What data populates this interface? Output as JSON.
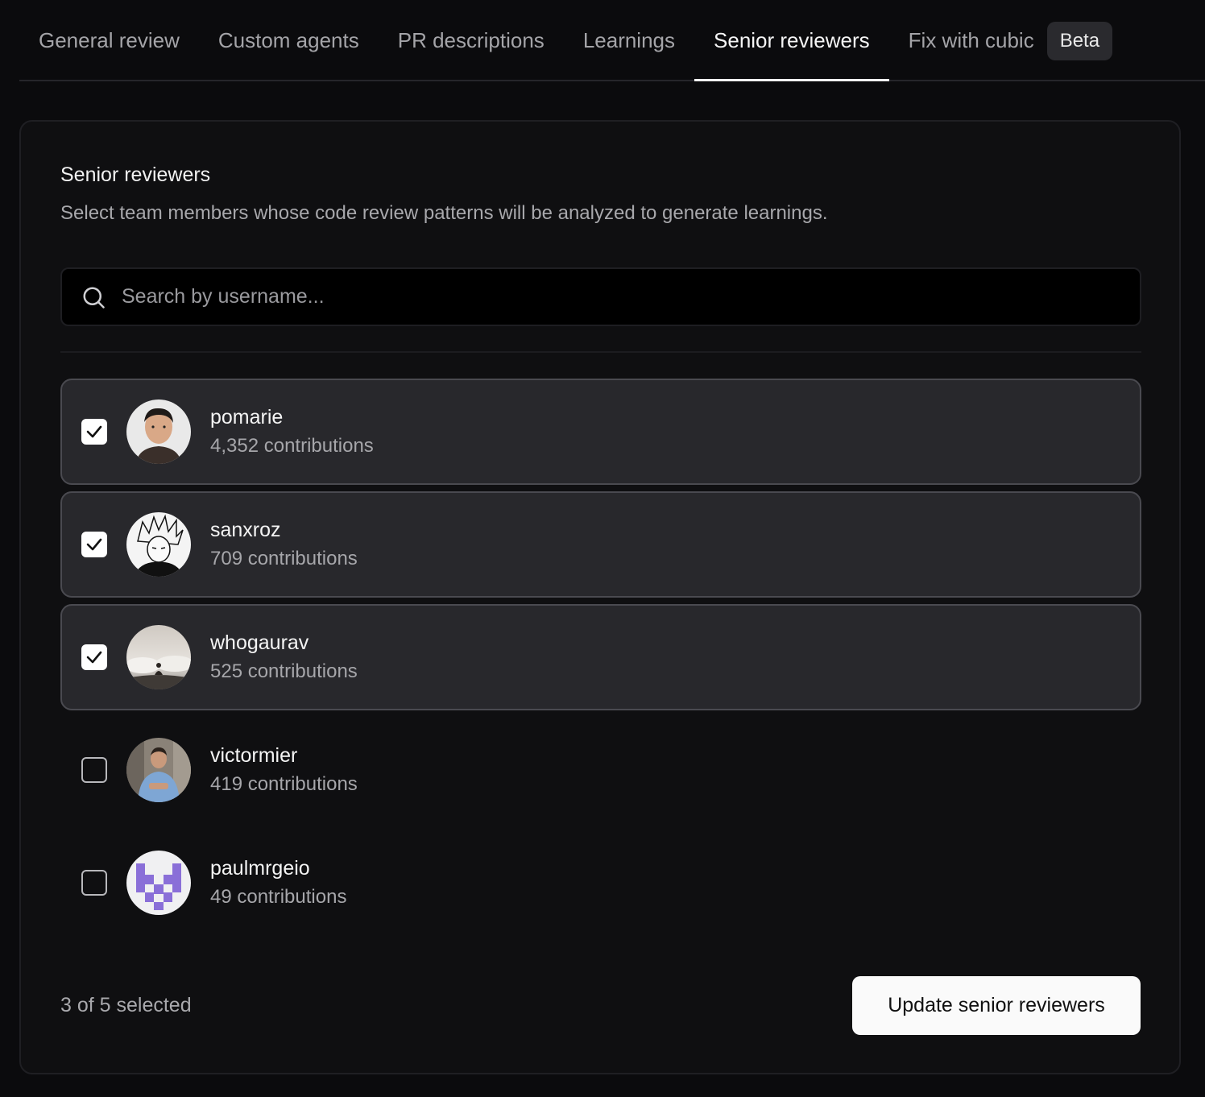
{
  "tabs": [
    {
      "label": "General review"
    },
    {
      "label": "Custom agents"
    },
    {
      "label": "PR descriptions"
    },
    {
      "label": "Learnings"
    },
    {
      "label": "Senior reviewers",
      "active": true
    },
    {
      "label": "Fix with cubic",
      "badge": "Beta"
    }
  ],
  "section": {
    "title": "Senior reviewers",
    "description": "Select team members whose code review patterns will be analyzed to generate learnings."
  },
  "search": {
    "placeholder": "Search by username...",
    "value": "",
    "icon": "search-icon"
  },
  "reviewers": [
    {
      "username": "pomarie",
      "contributions": "4,352 contributions",
      "selected": true
    },
    {
      "username": "sanxroz",
      "contributions": "709 contributions",
      "selected": true
    },
    {
      "username": "whogaurav",
      "contributions": "525 contributions",
      "selected": true
    },
    {
      "username": "victormier",
      "contributions": "419 contributions",
      "selected": false
    },
    {
      "username": "paulmrgeio",
      "contributions": "49 contributions",
      "selected": false
    }
  ],
  "footer": {
    "selected_count": "3 of 5 selected",
    "update_label": "Update senior reviewers"
  },
  "colors": {
    "background": "#0b0b0d",
    "card": "#0f0f11",
    "selected_row": "#28282c",
    "accent": "#fafafa"
  }
}
